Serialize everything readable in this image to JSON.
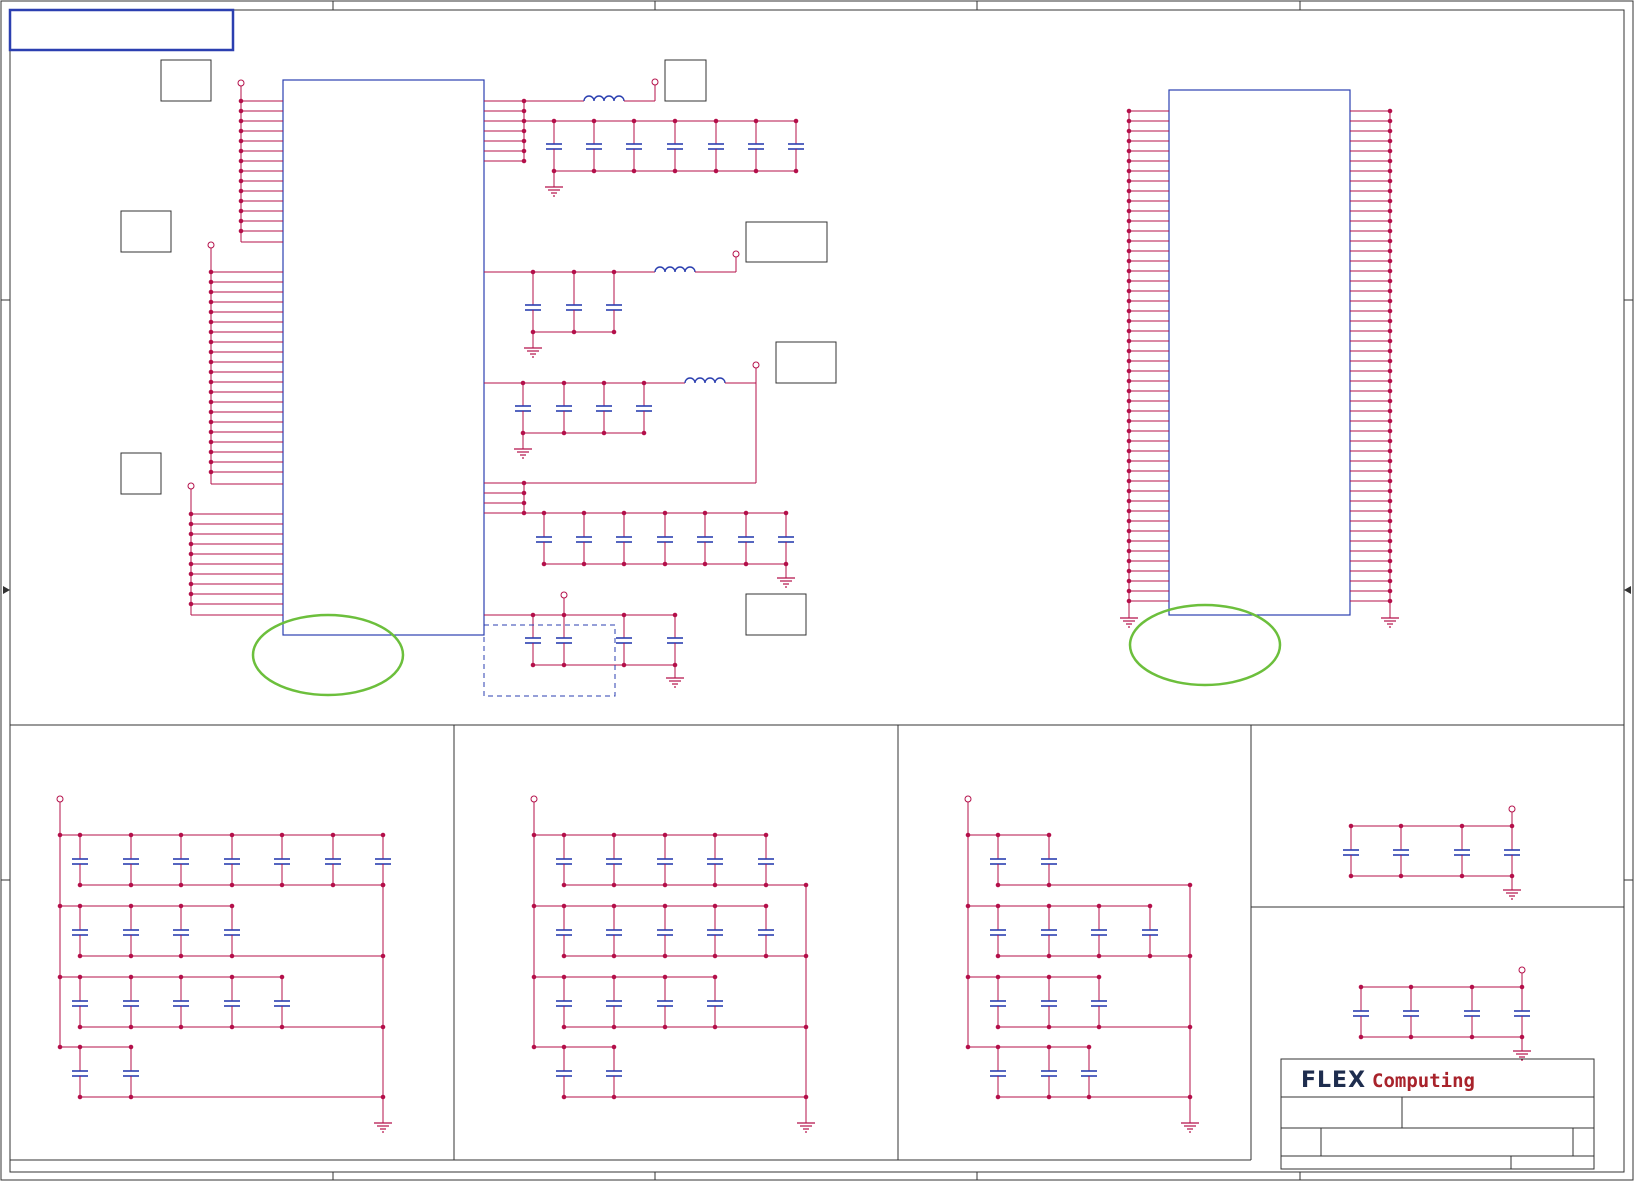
{
  "title_block": {
    "logo_primary": "FLEX",
    "logo_secondary": "Computing"
  },
  "colors": {
    "wire": "#b4104a",
    "component": "#2b3fb0",
    "frame": "#333333",
    "ellipse_highlight": "#6cbf3c",
    "title_box_highlight": "#2b3fb0",
    "logo_primary": "#1e2d4e",
    "logo_secondary": "#a8232b"
  }
}
